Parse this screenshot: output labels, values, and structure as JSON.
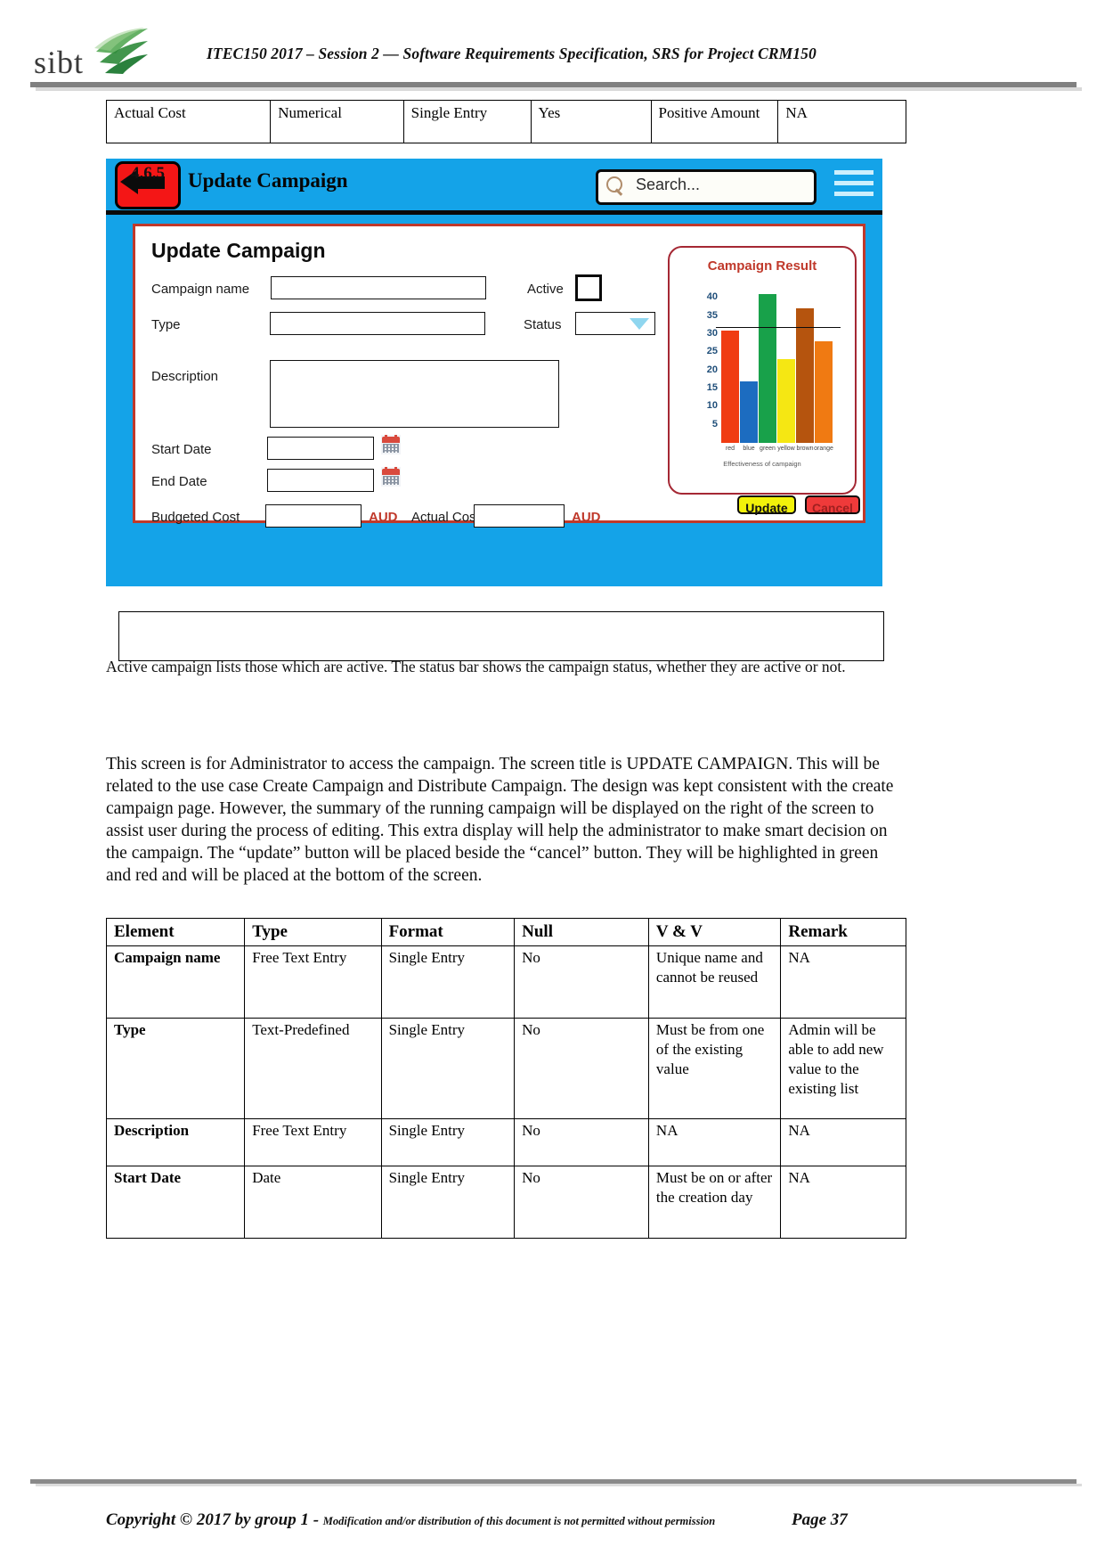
{
  "header": {
    "logo_text": "sibt",
    "logo_icon": "green-swoosh-icon",
    "title": "ITEC150 2017 – Session 2 — Software Requirements Specification, SRS for Project CRM150"
  },
  "top_table": {
    "row": [
      "Actual Cost",
      "Numerical",
      "Single Entry",
      "Yes",
      "Positive Amount",
      "NA"
    ]
  },
  "mockup": {
    "section_number": "4.6.5",
    "app_title": "Update Campaign",
    "back_icon": "back-arrow-icon",
    "menu_icon": "hamburger-menu-icon",
    "search": {
      "icon": "search-icon",
      "placeholder": "Search..."
    },
    "form": {
      "title": "Update Campaign",
      "fields": {
        "campaign_name_label": "Campaign name",
        "campaign_name_value": "",
        "type_label": "Type",
        "type_value": "",
        "description_label": "Description",
        "description_value": "",
        "start_date_label": "Start Date",
        "start_date_value": "",
        "end_date_label": "End Date",
        "end_date_value": "",
        "budgeted_cost_label": "Budgeted Cost",
        "budgeted_cost_value": "",
        "budgeted_currency": "AUD",
        "actual_cost_label": "Actual Cost",
        "actual_cost_value": "",
        "actual_currency": "AUD",
        "active_label": "Active",
        "active_checked": false,
        "status_label": "Status",
        "status_value": ""
      },
      "buttons": {
        "update": "Update",
        "cancel": "Cancel"
      }
    },
    "chart_data": {
      "type": "bar",
      "title": "Campaign Result",
      "caption": "Effectiveness of campaign",
      "categories": [
        "red",
        "blue",
        "green",
        "yellow",
        "brown",
        "orange"
      ],
      "values": [
        31,
        17,
        41,
        23,
        37,
        28
      ],
      "colors": [
        "#f03c12",
        "#1c6cc0",
        "#18a14a",
        "#f5e713",
        "#b5540e",
        "#f07a12"
      ],
      "ylabel": "",
      "xlabel": "",
      "yticks": [
        40,
        35,
        30,
        25,
        20,
        15,
        10,
        5
      ],
      "ylim": [
        0,
        43
      ],
      "grid": true,
      "legend": "none"
    }
  },
  "caption_box_text": "",
  "caption_line": "Active campaign lists those which are active. The status bar shows the campaign status, whether they are active or not.",
  "paragraph": "This screen is for Administrator to access the campaign. The screen title is UPDATE CAMPAIGN. This will be related to the use case Create Campaign and Distribute Campaign. The design was kept consistent with the create campaign page. However, the summary of the running campaign will be displayed on the right of the screen to assist user during the process of editing. This extra display will help the administrator to make smart decision on the campaign. The “update” button will be placed beside the “cancel” button. They will be highlighted in green and red and will be placed at the bottom of the screen.",
  "element_table": {
    "headers": [
      "Element",
      "Type",
      "Format",
      "Null",
      "V & V",
      "Remark"
    ],
    "rows": [
      [
        "Campaign name",
        "Free Text Entry",
        "Single Entry",
        "No",
        "Unique name and cannot be reused",
        "NA"
      ],
      [
        "Type",
        "Text-Predefined",
        "Single Entry",
        "No",
        "Must be from one of the existing value",
        "Admin will be able to add new value to the existing list"
      ],
      [
        "Description",
        "Free Text Entry",
        "Single Entry",
        "No",
        "NA",
        "NA"
      ],
      [
        "Start Date",
        "Date",
        "Single Entry",
        "No",
        "Must be on or after the creation day",
        "NA"
      ]
    ]
  },
  "footer": {
    "copyright": "Copyright © 2017 by group 1 - ",
    "note": "Modification and/or distribution of this document is not permitted without permission",
    "page": "Page 37"
  }
}
